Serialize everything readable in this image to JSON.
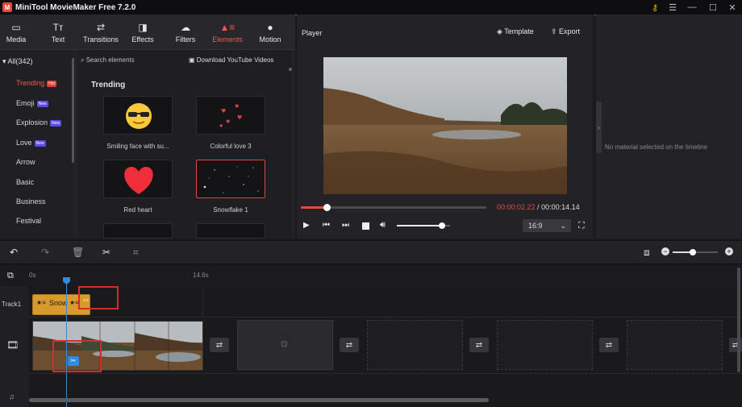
{
  "app": {
    "title": "MiniTool MovieMaker Free 7.2.0",
    "logo_letter": "M"
  },
  "window_controls": {
    "key": "⚷",
    "menu": "☰",
    "minimize": "—",
    "maximize": "☐",
    "close": "✕"
  },
  "tabs": [
    {
      "label": "Media",
      "icon": "▭"
    },
    {
      "label": "Text",
      "icon": "Tт"
    },
    {
      "label": "Transitions",
      "icon": "⇄"
    },
    {
      "label": "Effects",
      "icon": "◨"
    },
    {
      "label": "Filters",
      "icon": "☁"
    },
    {
      "label": "Elements",
      "icon": "▲≡"
    },
    {
      "label": "Motion",
      "icon": "●"
    }
  ],
  "categories": {
    "header": "All(342)",
    "items": [
      {
        "label": "Trending",
        "badge": "Hot"
      },
      {
        "label": "Emoji",
        "badge": "New"
      },
      {
        "label": "Explosion",
        "badge": "New"
      },
      {
        "label": "Love",
        "badge": "New"
      },
      {
        "label": "Arrow",
        "badge": ""
      },
      {
        "label": "Basic",
        "badge": ""
      },
      {
        "label": "Business",
        "badge": ""
      },
      {
        "label": "Festival",
        "badge": ""
      }
    ]
  },
  "search": {
    "placeholder": "Search elements",
    "download_label": "Download YouTube Videos"
  },
  "section_title": "Trending",
  "elements": [
    {
      "label": "Smiling face with su..."
    },
    {
      "label": "Colorful love 3"
    },
    {
      "label": "Red heart"
    },
    {
      "label": "Snowflake 1"
    }
  ],
  "player": {
    "title": "Player",
    "template_label": "Template",
    "export_label": "Export",
    "current_time": "00:00:02.22",
    "separator": " / ",
    "total_time": "00:00:14.14",
    "aspect_ratio": "16:9",
    "progress": 0.14,
    "volume": 0.85
  },
  "properties": {
    "empty_message": "No material selected on the timeline"
  },
  "timeline": {
    "ruler_start": "0s",
    "ruler_mark": "14.6s",
    "track1_label": "Track1",
    "element_clip_label": "Snow",
    "zoom": 0.45
  }
}
